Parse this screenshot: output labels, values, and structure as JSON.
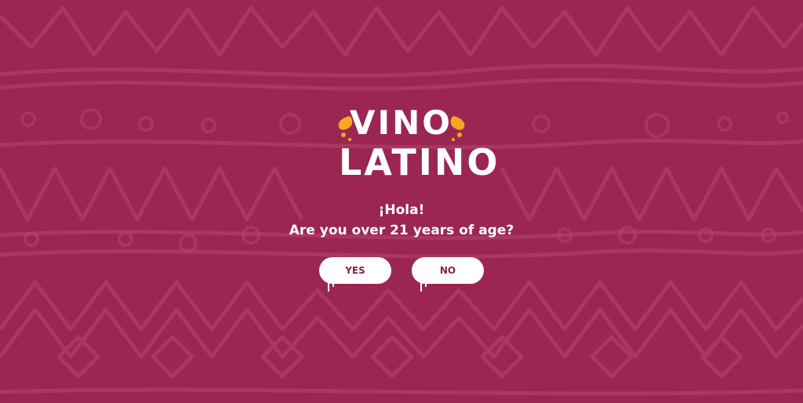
{
  "brand": {
    "logo_line1": "VINO",
    "logo_line2": "LATINO",
    "accent_color": "#f6a623",
    "background_color": "#9b2652"
  },
  "age_gate": {
    "greeting": "¡Hola!",
    "question": "Are you over 21 years of age?",
    "yes_label": "YES",
    "no_label": "NO"
  }
}
